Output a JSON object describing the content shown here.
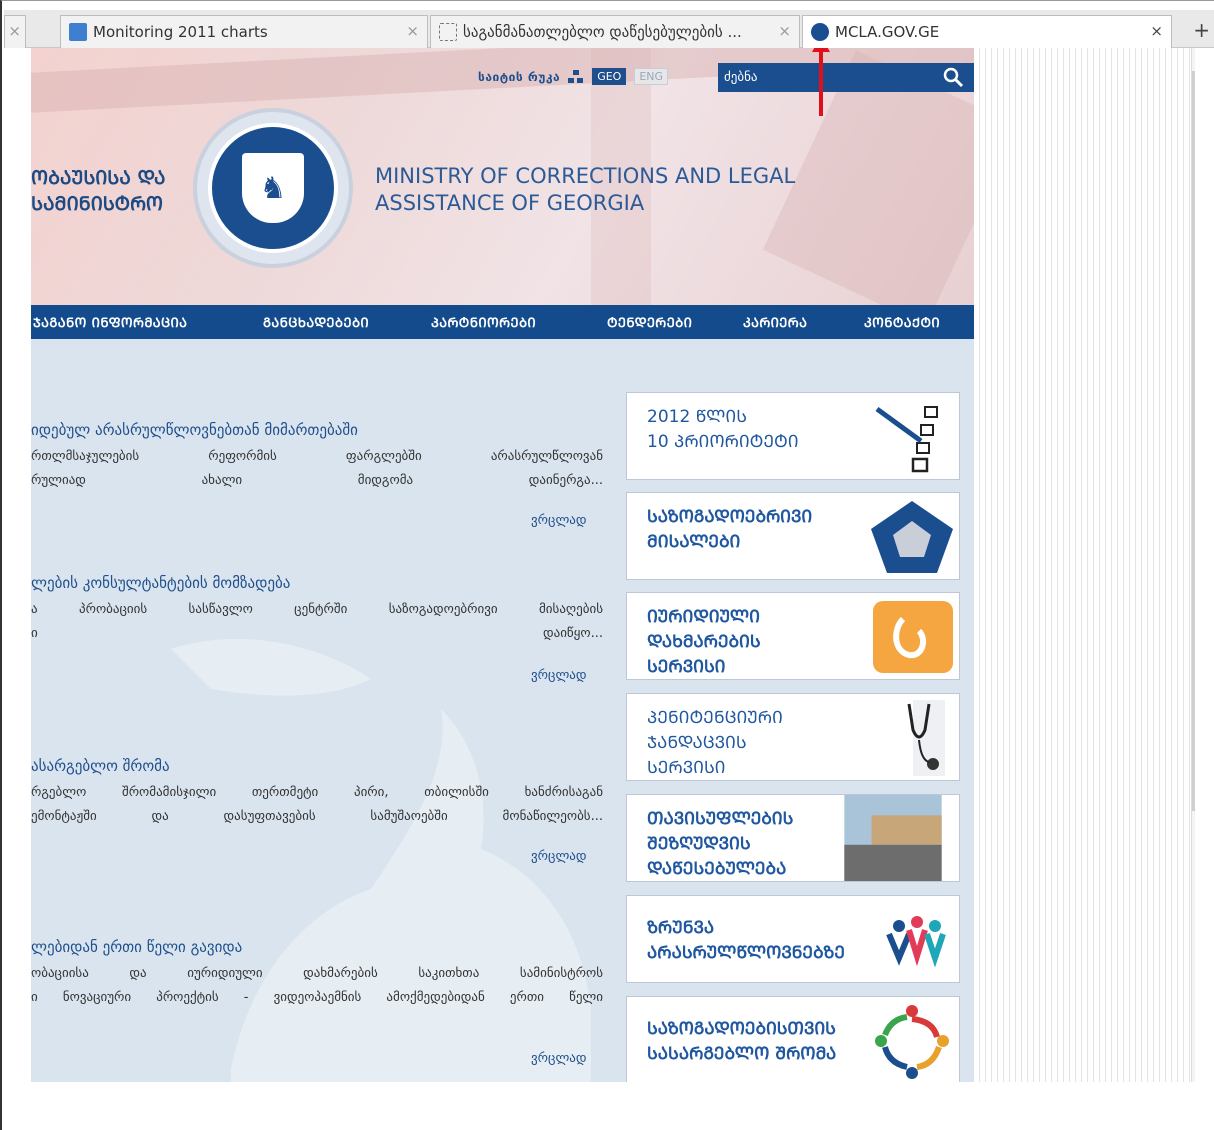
{
  "tabs": [
    {
      "label": "Monitoring 2011 charts",
      "active": false
    },
    {
      "label": "საგანმანათლებლო დაწესებულების ...",
      "active": false
    },
    {
      "label": "MCLA.GOV.GE",
      "active": true
    }
  ],
  "header": {
    "sitemap": "საიტის რუკა",
    "lang_geo": "GEO",
    "lang_eng": "ENG",
    "search_placeholder": "ძებნა",
    "geo_title": "ᲝᲑᲐᲣᲡᲘᲡᲐ ᲓᲐ\nᲡᲐᲛᲘᲜᲘᲡᲢᲠᲝ",
    "en_title": "MINISTRY OF CORRECTIONS AND LEGAL\nASSISTANCE OF GEORGIA"
  },
  "nav": [
    "ᲯᲐᲒᲐᲜᲝ ᲘᲜᲤᲝᲠᲛᲐᲪᲘᲐ",
    "ᲒᲐᲜᲪᲮᲐᲓᲔᲑᲔᲑᲘ",
    "ᲞᲐᲠᲢᲜᲘᲝᲠᲔᲑᲘ",
    "ᲢᲔᲜᲓᲔᲠᲔᲑᲘ",
    "ᲙᲐᲠᲘᲔᲠᲐ",
    "ᲙᲝᲜᲢᲐᲥᲢᲘ"
  ],
  "news": [
    {
      "title": "იდებულ არასრულწლოვნებთან მიმართებაში",
      "line1": "რთლმსაჯულების რეფორმის ფარგლებში არასრულწლოვან",
      "line2": "რულიად ახალი მიდგომა დაინერგა...",
      "more": "ვრცლად"
    },
    {
      "title": "ლების კონსულტანტების მომზადება",
      "line1": "ა პრობაციის სასწავლო ცენტრში საზოგადოებრივი მისაღების",
      "line2": "ი დაიწყო...",
      "more": "ვრცლად"
    },
    {
      "title": "ასარგებლო შრომა",
      "line1": "რგებლო შრომამისჯილი თერთმეტი პირი, თბილისში ხანძრისაგან",
      "line2": "ემონტაჟში და დასუფთავების სამუშაოებში მონაწილეობს...",
      "more": "ვრცლად"
    },
    {
      "title": "ლებიდან ერთი წელი გავიდა",
      "line1": "ობაციისა და იურიდიული დახმარების საკითხთა სამინისტროს",
      "line2": "ი ნოვაციური პროექტის - ვიდეოპაემნის ამოქმედებიდან ერთი წელი",
      "more": "ვრცლად"
    }
  ],
  "banners": [
    {
      "text": "2012 ᲬᲚᲘᲡ\n10 ᲞᲠᲘᲝᲠᲘᲢᲔᲢᲘ",
      "icon": "checklist-pen-icon"
    },
    {
      "text": "ᲡᲐᲖᲝᲒᲐᲓᲝᲔᲑᲠᲘᲕᲘ\nᲛᲘᲡᲐᲚᲔᲑᲘ",
      "icon": "pentagon-icon"
    },
    {
      "text": "ᲘᲣᲠᲘᲓᲘᲣᲚᲘ\nᲓᲐᲮᲛᲐᲠᲔᲑᲘᲡ\nᲡᲔᲠᲕᲘᲡᲘ",
      "icon": "legal-aid-icon"
    },
    {
      "text": "ᲞᲔᲜᲘᲢᲔᲜᲪᲘᲣᲠᲘ\nᲯᲐᲜᲓᲐᲪᲕᲘᲡ\nᲡᲔᲠᲕᲘᲡᲘ",
      "icon": "stethoscope-icon"
    },
    {
      "text": "ᲗᲐᲕᲘᲡᲣᲤᲚᲔᲑᲘᲡ\nᲨᲔᲖᲦᲣᲓᲕᲘᲡ\nᲓᲐᲬᲔᲡᲔᲑᲣᲚᲔᲑᲐ",
      "icon": "building-icon"
    },
    {
      "text": "ᲖᲠᲣᲜᲕᲐ\nᲐᲠᲐᲡᲠᲣᲚᲬᲚᲝᲕᲜᲔᲑᲖᲔ",
      "icon": "children-icon"
    },
    {
      "text": "ᲡᲐᲖᲝᲒᲐᲓᲝᲔᲑᲘᲡᲗᲕᲘᲡ\nᲡᲐᲡᲐᲠᲒᲔᲑᲚᲝ ᲨᲠᲝᲛᲐ",
      "icon": "community-circle-icon"
    }
  ],
  "colors": {
    "brand": "#144b8c",
    "link": "#1e4f8c",
    "annotation": "#e0101a"
  }
}
